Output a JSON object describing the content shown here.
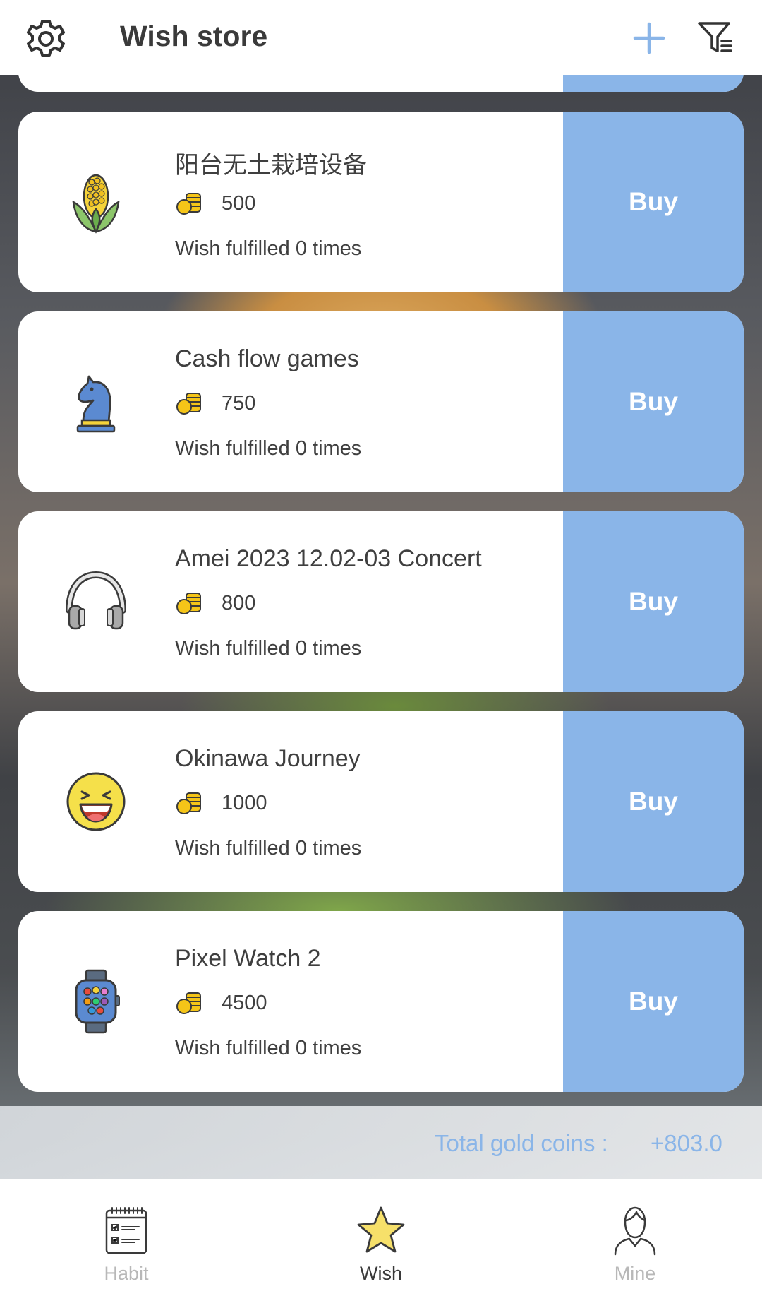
{
  "header": {
    "title": "Wish store",
    "icons": {
      "settings": "gear-icon",
      "add": "plus-icon",
      "filter": "filter-icon"
    }
  },
  "wishes": [
    {
      "name": "阳台无土栽培设备",
      "price": "500",
      "fulfilled": "Wish fulfilled 0 times",
      "buy_label": "Buy",
      "icon": "corn-icon"
    },
    {
      "name": "Cash flow games",
      "price": "750",
      "fulfilled": "Wish fulfilled 0 times",
      "buy_label": "Buy",
      "icon": "chess-knight-icon"
    },
    {
      "name": "Amei 2023 12.02-03 Concert",
      "price": "800",
      "fulfilled": "Wish fulfilled 0 times",
      "buy_label": "Buy",
      "icon": "headphones-icon"
    },
    {
      "name": "Okinawa Journey",
      "price": "1000",
      "fulfilled": "Wish fulfilled 0 times",
      "buy_label": "Buy",
      "icon": "laughing-emoji-icon"
    },
    {
      "name": "Pixel Watch 2",
      "price": "4500",
      "fulfilled": "Wish fulfilled 0 times",
      "buy_label": "Buy",
      "icon": "smartwatch-icon"
    }
  ],
  "total": {
    "label": "Total gold coins :",
    "value": "+803.0"
  },
  "nav": {
    "habit": "Habit",
    "wish": "Wish",
    "mine": "Mine",
    "active": "wish"
  },
  "colors": {
    "accent": "#8ab5e8",
    "text": "#3f3f3f",
    "inactive": "#b8b8b8",
    "star": "#f6e06a"
  }
}
